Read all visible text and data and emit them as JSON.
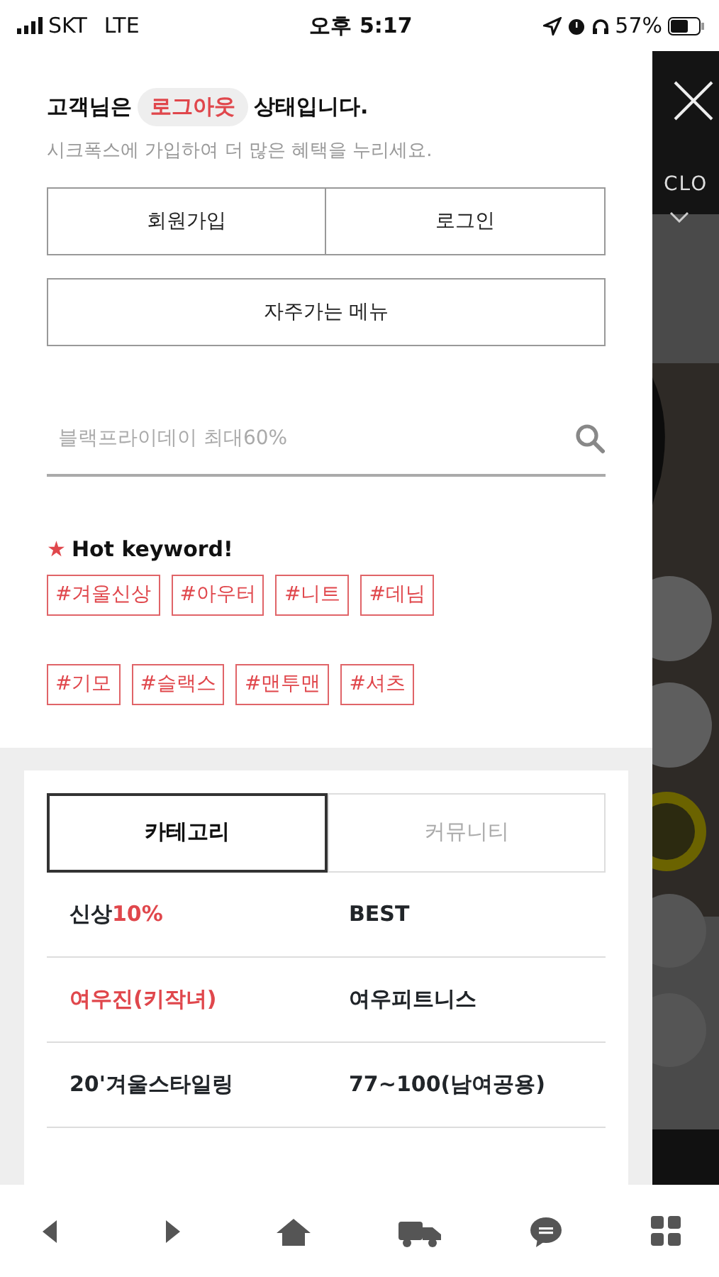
{
  "status_bar": {
    "carrier": "SKT",
    "network": "LTE",
    "time": "오후 5:17",
    "battery": "57%"
  },
  "background_page": {
    "menu_label": "CLO"
  },
  "drawer": {
    "greeting_prefix": "고객님은",
    "status_badge": "로그아웃",
    "greeting_suffix": "상태입니다.",
    "subtitle": "시크폭스에 가입하여 더 많은 혜택을 누리세요.",
    "auth_buttons": [
      "회원가입",
      "로그인"
    ],
    "frequent_menu_button": "자주가는 메뉴",
    "search": {
      "placeholder": "블랙프라이데이 최대60%"
    },
    "hot_keyword": {
      "star": "★",
      "title": "Hot keyword!"
    },
    "tags": [
      [
        "#겨울신상",
        "#아우터",
        "#니트",
        "#데님"
      ],
      [
        "#기모",
        "#슬랙스",
        "#맨투맨",
        "#셔츠"
      ]
    ],
    "tabs": [
      {
        "label": "카테고리",
        "selected": true
      },
      {
        "label": "커뮤니티",
        "selected": false
      }
    ],
    "categories": [
      [
        {
          "parts": [
            {
              "text": "신상",
              "accent": false
            },
            {
              "text": "10%",
              "accent": true
            }
          ]
        },
        {
          "parts": [
            {
              "text": "BEST",
              "accent": false
            }
          ]
        }
      ],
      [
        {
          "parts": [
            {
              "text": "여우진(키작녀)",
              "accent": true
            }
          ]
        },
        {
          "parts": [
            {
              "text": "여우피트니스",
              "accent": false
            }
          ]
        }
      ],
      [
        {
          "parts": [
            {
              "text": "20'겨울스타일링",
              "accent": false
            }
          ]
        },
        {
          "parts": [
            {
              "text": "77~100(남여공용)",
              "accent": false
            }
          ]
        }
      ]
    ]
  }
}
